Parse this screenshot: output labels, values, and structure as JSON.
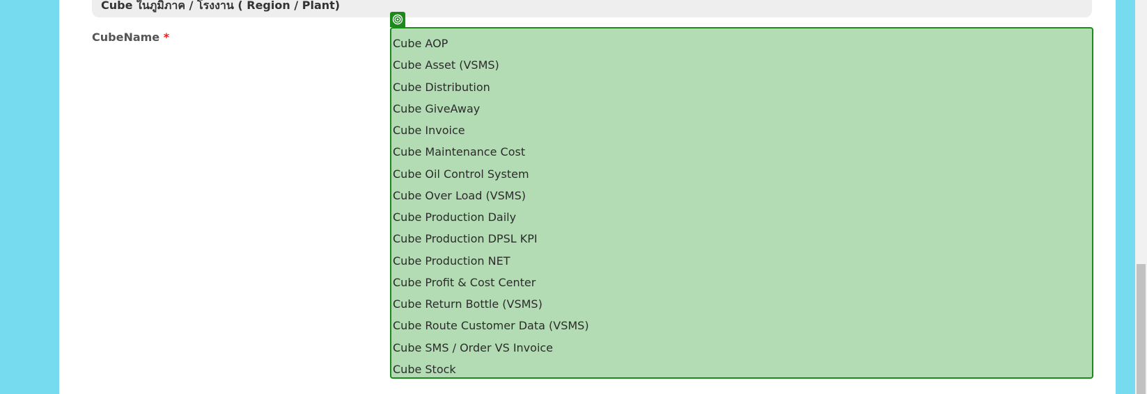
{
  "section": {
    "title": "Cube ในภูมิภาค / โรงงาน ( Region / Plant)"
  },
  "field": {
    "label": "CubeName",
    "required_mark": "*"
  },
  "picker": {
    "icon": "target-icon"
  },
  "options": [
    "Cube AOP",
    "Cube Asset (VSMS)",
    "Cube Distribution",
    "Cube GiveAway",
    "Cube Invoice",
    "Cube Maintenance Cost",
    "Cube Oil Control System",
    "Cube Over Load (VSMS)",
    "Cube Production Daily",
    "Cube Production DPSL KPI",
    "Cube Production NET",
    "Cube Profit & Cost Center",
    "Cube Return Bottle (VSMS)",
    "Cube Route Customer Data (VSMS)",
    "Cube SMS / Order VS Invoice",
    "Cube Stock"
  ],
  "colors": {
    "background": "#76dbef",
    "listbox_fill": "#b4dcb4",
    "listbox_border": "#1b8a1b",
    "required": "#e01e1e"
  }
}
